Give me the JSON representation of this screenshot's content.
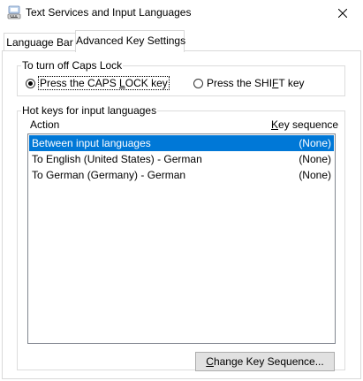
{
  "window": {
    "title": "Text Services and Input Languages",
    "close_label": "✕"
  },
  "tabs": [
    {
      "label": "Language Bar",
      "active": false
    },
    {
      "label": "Advanced Key Settings",
      "active": true
    }
  ],
  "caps_lock": {
    "group_label": "To turn off Caps Lock",
    "option1_pre": "Press the CAPS ",
    "option1_u": "L",
    "option1_post": "OCK key",
    "option2_pre": "Press the SHI",
    "option2_u": "F",
    "option2_post": "T key",
    "selected": "option1"
  },
  "hotkeys": {
    "group_label": "Hot keys for input languages",
    "col_action": "Action",
    "col_key_pre": "",
    "col_key_u": "K",
    "col_key_post": "ey sequence",
    "rows": [
      {
        "action": "Between input languages",
        "sequence": "(None)",
        "selected": true
      },
      {
        "action": "To English (United States) - German",
        "sequence": "(None)",
        "selected": false
      },
      {
        "action": "To German (Germany) - German",
        "sequence": "(None)",
        "selected": false
      }
    ]
  },
  "button": {
    "pre": "",
    "u": "C",
    "post": "hange Key Sequence..."
  },
  "colors": {
    "selection": "#0078d7",
    "border": "#dcdcdc"
  }
}
